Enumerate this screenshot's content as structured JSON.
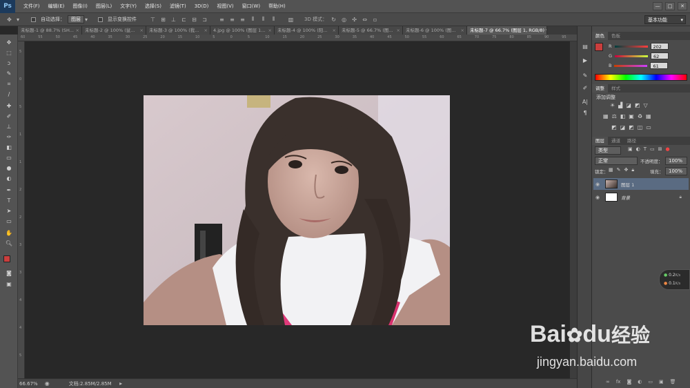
{
  "app": {
    "logo": "Ps"
  },
  "menu": [
    "文件(F)",
    "编辑(E)",
    "图像(I)",
    "图层(L)",
    "文字(Y)",
    "选择(S)",
    "滤镜(T)",
    "3D(D)",
    "视图(V)",
    "窗口(W)",
    "帮助(H)"
  ],
  "window_controls": [
    "—",
    "□",
    "✕"
  ],
  "options": {
    "auto_select_label": "自动选择：",
    "auto_select_value": "图层",
    "show_transform_label": "显示变换控件",
    "mode3d_label": "3D 模式：",
    "workspace": "基本功能"
  },
  "tabs": [
    "未标题-1 @ 88.7% (SH...",
    "未标题-2 @ 100% (鼠...",
    "未标题-3 @ 100% (我...",
    "4.jpg @ 100% (图层 1...",
    "未标题-4 @ 100% (阳...",
    "未标题-5 @ 66.7% (图...",
    "未标题-6 @ 100% (图...",
    "未标题-7 @ 66.7% (图层 1, RGB/8) *"
  ],
  "ruler_h": [
    "60",
    "55",
    "50",
    "45",
    "40",
    "35",
    "30",
    "25",
    "20",
    "15",
    "10",
    "5",
    "0",
    "5",
    "10",
    "15",
    "20",
    "25",
    "30",
    "35",
    "40",
    "45",
    "50",
    "55",
    "60",
    "65",
    "70",
    "75",
    "80",
    "85",
    "90",
    "95"
  ],
  "ruler_v": [
    "5",
    "0",
    "5",
    "1",
    "1",
    "2",
    "2",
    "3",
    "3",
    "4",
    "4",
    "5"
  ],
  "status": {
    "zoom": "66.67%",
    "doc": "文档:2.85M/2.85M"
  },
  "color_panel": {
    "tabs": [
      "颜色",
      "色板"
    ],
    "r": {
      "label": "R",
      "value": "202"
    },
    "g": {
      "label": "G",
      "value": "62"
    },
    "b": {
      "label": "B",
      "value": "61"
    },
    "fg": "#ca3e3d",
    "bg": "#f2e2a0"
  },
  "adjust_panel": {
    "tabs": [
      "调整",
      "样式"
    ],
    "title": "添加调整"
  },
  "layers_panel": {
    "tabs": [
      "图层",
      "通道",
      "路径"
    ],
    "filter": "类型",
    "blend_mode": "正常",
    "opacity_label": "不透明度：",
    "opacity": "100%",
    "lock_label": "锁定：",
    "fill_label": "填充：",
    "fill": "100%",
    "layers": [
      {
        "name": "图层 1",
        "selected": true
      },
      {
        "name": "背景",
        "selected": false
      }
    ]
  },
  "net_widget": {
    "up": "0.2",
    "down": "0.1",
    "unit": "K/s"
  },
  "watermark": {
    "brand": "Bai",
    "brand_tail": "du",
    "product": "经验",
    "url": "jingyan.baidu.com"
  },
  "icons": {
    "move": "move-icon",
    "marquee": "marquee-icon",
    "lasso": "lasso-icon",
    "quick-select": "quick-select-icon",
    "crop": "crop-icon",
    "eyedropper": "eyedropper-icon",
    "heal": "healing-brush-icon",
    "brush": "brush-icon",
    "stamp": "clone-stamp-icon",
    "history": "history-brush-icon",
    "eraser": "eraser-icon",
    "gradient": "gradient-icon",
    "blur": "blur-icon",
    "dodge": "dodge-icon",
    "pen": "pen-icon",
    "type": "type-icon",
    "path-select": "path-select-icon",
    "shape": "shape-icon",
    "hand": "hand-icon",
    "zoom": "zoom-icon"
  }
}
